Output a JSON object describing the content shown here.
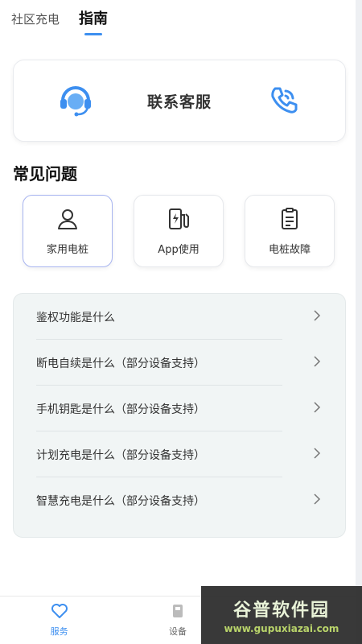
{
  "tabs": [
    {
      "label": "社区充电"
    },
    {
      "label": "指南"
    }
  ],
  "contact": {
    "title": "联系客服"
  },
  "faq": {
    "heading": "常见问题",
    "categories": [
      {
        "label": "家用电桩"
      },
      {
        "label": "App使用"
      },
      {
        "label": "电桩故障"
      }
    ],
    "items": [
      {
        "text": "鉴权功能是什么"
      },
      {
        "text": "断电自续是什么（部分设备支持）"
      },
      {
        "text": "手机钥匙是什么（部分设备支持）"
      },
      {
        "text": "计划充电是什么（部分设备支持）"
      },
      {
        "text": "智慧充电是什么（部分设备支持）"
      }
    ]
  },
  "nav": {
    "items": [
      {
        "label": "服务"
      },
      {
        "label": "设备"
      }
    ]
  },
  "watermark": {
    "text": "谷普软件园",
    "url": "www.gupuxiazai.com"
  },
  "colors": {
    "accent": "#3d8ff0",
    "card_border_selected": "#a7b4f0"
  }
}
